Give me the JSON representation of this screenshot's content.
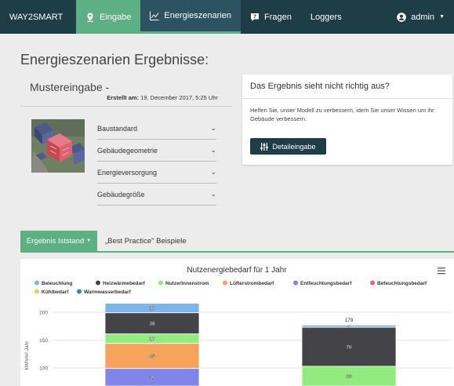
{
  "nav": {
    "brand": "WAY2SMART",
    "items": [
      {
        "label": "Eingabe",
        "icon": "location-pin-icon"
      },
      {
        "label": "Energieszenarien",
        "icon": "line-chart-icon"
      },
      {
        "label": "Fragen",
        "icon": "question-icon"
      },
      {
        "label": "Loggers"
      }
    ],
    "user": "admin",
    "user_icon": "user-circle-icon"
  },
  "page_title": "Energieszenarien Ergebnisse:",
  "left": {
    "title": "Mustereingabe -",
    "created_label": "Erstellt am:",
    "created_value": " 19. December 2017, 5:25 Uhr",
    "sections": [
      "Baustandard",
      "Gebäudegeometrie",
      "Energieversorgung",
      "Gebäudegröße"
    ]
  },
  "right": {
    "title": "Das Ergebnis sieht nicht richtig aus?",
    "text": "Helfen Sie, unser Modell zu verbessern, idem Sie unser Wissen um ihr Gebäude verbessern.",
    "button": "Detaileingabe"
  },
  "tabs": {
    "active": "Ergebnis Iststand",
    "other": "„Best Practice\" Beispiele"
  },
  "chart_data": {
    "type": "bar",
    "stacked": true,
    "title": "Nutzenergiebedarf für 1 Jahr",
    "ylabel": "kWh/m² Jahr",
    "yticks": [
      100,
      150,
      200
    ],
    "legend_position": "top",
    "series": [
      {
        "name": "Beleuchtung",
        "color": "#7cb5ec",
        "values": [
          17,
          4
        ]
      },
      {
        "name": "Heizwärmebedarf",
        "color": "#434348",
        "values": [
          38,
          70
        ]
      },
      {
        "name": "NutzerInnenstrom",
        "color": "#90ed7d",
        "values": [
          17,
          0
        ]
      },
      {
        "name": "Lüfterstrombedarf",
        "color": "#f7a35c",
        "values": [
          45,
          0
        ]
      },
      {
        "name": "Entfeuchtungsbedarf",
        "color": "#8085e9",
        "values": [
          39,
          0
        ]
      },
      {
        "name": "Befeuchtungsbedarf",
        "color": "#f15c80",
        "values": [
          0,
          0
        ]
      },
      {
        "name": "Kühlbedarf",
        "color": "#e4d354",
        "values": [
          0,
          0
        ]
      },
      {
        "name": "Warmwasserbedarf",
        "color": "#2b908f",
        "values": [
          0,
          0
        ]
      }
    ],
    "visible_segments": [
      {
        "bar": 0,
        "series": "Beleuchtung",
        "label": "17",
        "from": 199,
        "to": 216
      },
      {
        "bar": 0,
        "series": "Heizwärmebedarf",
        "label": "38",
        "from": 161,
        "to": 199
      },
      {
        "bar": 0,
        "series": "NutzerInnenstrom",
        "label": "17",
        "from": 144,
        "to": 161
      },
      {
        "bar": 0,
        "series": "Lüfterstrombedarf",
        "label": "45",
        "from": 99,
        "to": 144
      },
      {
        "bar": 0,
        "series": "Entfeuchtungsbedarf",
        "label": "39",
        "from": 60,
        "to": 99
      },
      {
        "bar": 1,
        "series": "Beleuchtung",
        "label": "4",
        "from": 173,
        "to": 177
      },
      {
        "bar": 1,
        "series": "Heizwärmebedarf",
        "label": "70",
        "from": 103,
        "to": 173
      },
      {
        "bar": 1,
        "series": "NutzerInnenstrom",
        "label": "65",
        "from": 40,
        "to": 103
      }
    ],
    "totals": [
      {
        "bar": 1,
        "label": "179",
        "value": 179
      }
    ]
  }
}
